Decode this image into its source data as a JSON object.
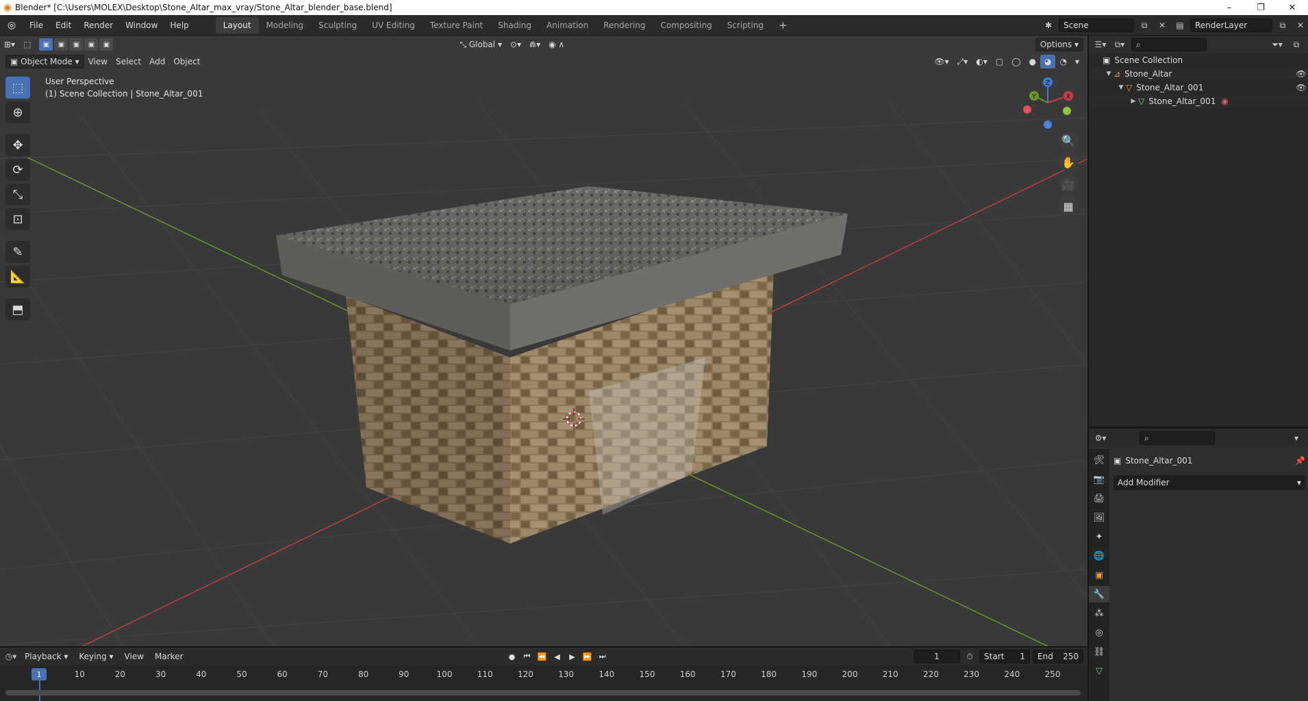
{
  "window": {
    "title": "Blender* [C:\\Users\\MOLEX\\Desktop\\Stone_Altar_max_vray/Stone_Altar_blender_base.blend]",
    "controls": [
      "–",
      "❐",
      "✕"
    ]
  },
  "menu": {
    "items": [
      "File",
      "Edit",
      "Render",
      "Window",
      "Help"
    ]
  },
  "workspaces": {
    "tabs": [
      "Layout",
      "Modeling",
      "Sculpting",
      "UV Editing",
      "Texture Paint",
      "Shading",
      "Animation",
      "Rendering",
      "Compositing",
      "Scripting"
    ],
    "active": "Layout",
    "add_label": "+"
  },
  "scene": {
    "name": "Scene",
    "render_layer": "RenderLayer"
  },
  "viewport": {
    "mode": "Object Mode",
    "menus": [
      "View",
      "Select",
      "Add",
      "Object"
    ],
    "transform_orientation": "Global",
    "options_label": "Options",
    "overlay_line1": "User Perspective",
    "overlay_line2": "(1) Scene Collection | Stone_Altar_001",
    "gizmo_axes": {
      "x": "X",
      "y": "Y",
      "z": "Z"
    },
    "colors": {
      "background": "#393939",
      "x_axis": "#c83c4a",
      "y_axis": "#6b9a2a",
      "z_axis": "#3b7ad8",
      "selection": "#4772b3"
    }
  },
  "outliner": {
    "root": "Scene Collection",
    "rows": [
      {
        "label": "Stone_Altar",
        "depth": 1
      },
      {
        "label": "Stone_Altar_001",
        "depth": 2
      },
      {
        "label": "Stone_Altar_001",
        "depth": 3
      }
    ]
  },
  "properties": {
    "object_name": "Stone_Altar_001",
    "add_modifier_label": "Add Modifier"
  },
  "timeline": {
    "menus": [
      "Playback",
      "Keying",
      "View",
      "Marker"
    ],
    "current_frame": "1",
    "start_label": "Start",
    "start": "1",
    "end_label": "End",
    "end": "250",
    "ruler": [
      "10",
      "20",
      "30",
      "40",
      "50",
      "60",
      "70",
      "80",
      "90",
      "100",
      "110",
      "120",
      "130",
      "140",
      "150",
      "160",
      "170",
      "180",
      "190",
      "200",
      "210",
      "220",
      "230",
      "240",
      "250"
    ],
    "playhead_label": "1"
  }
}
